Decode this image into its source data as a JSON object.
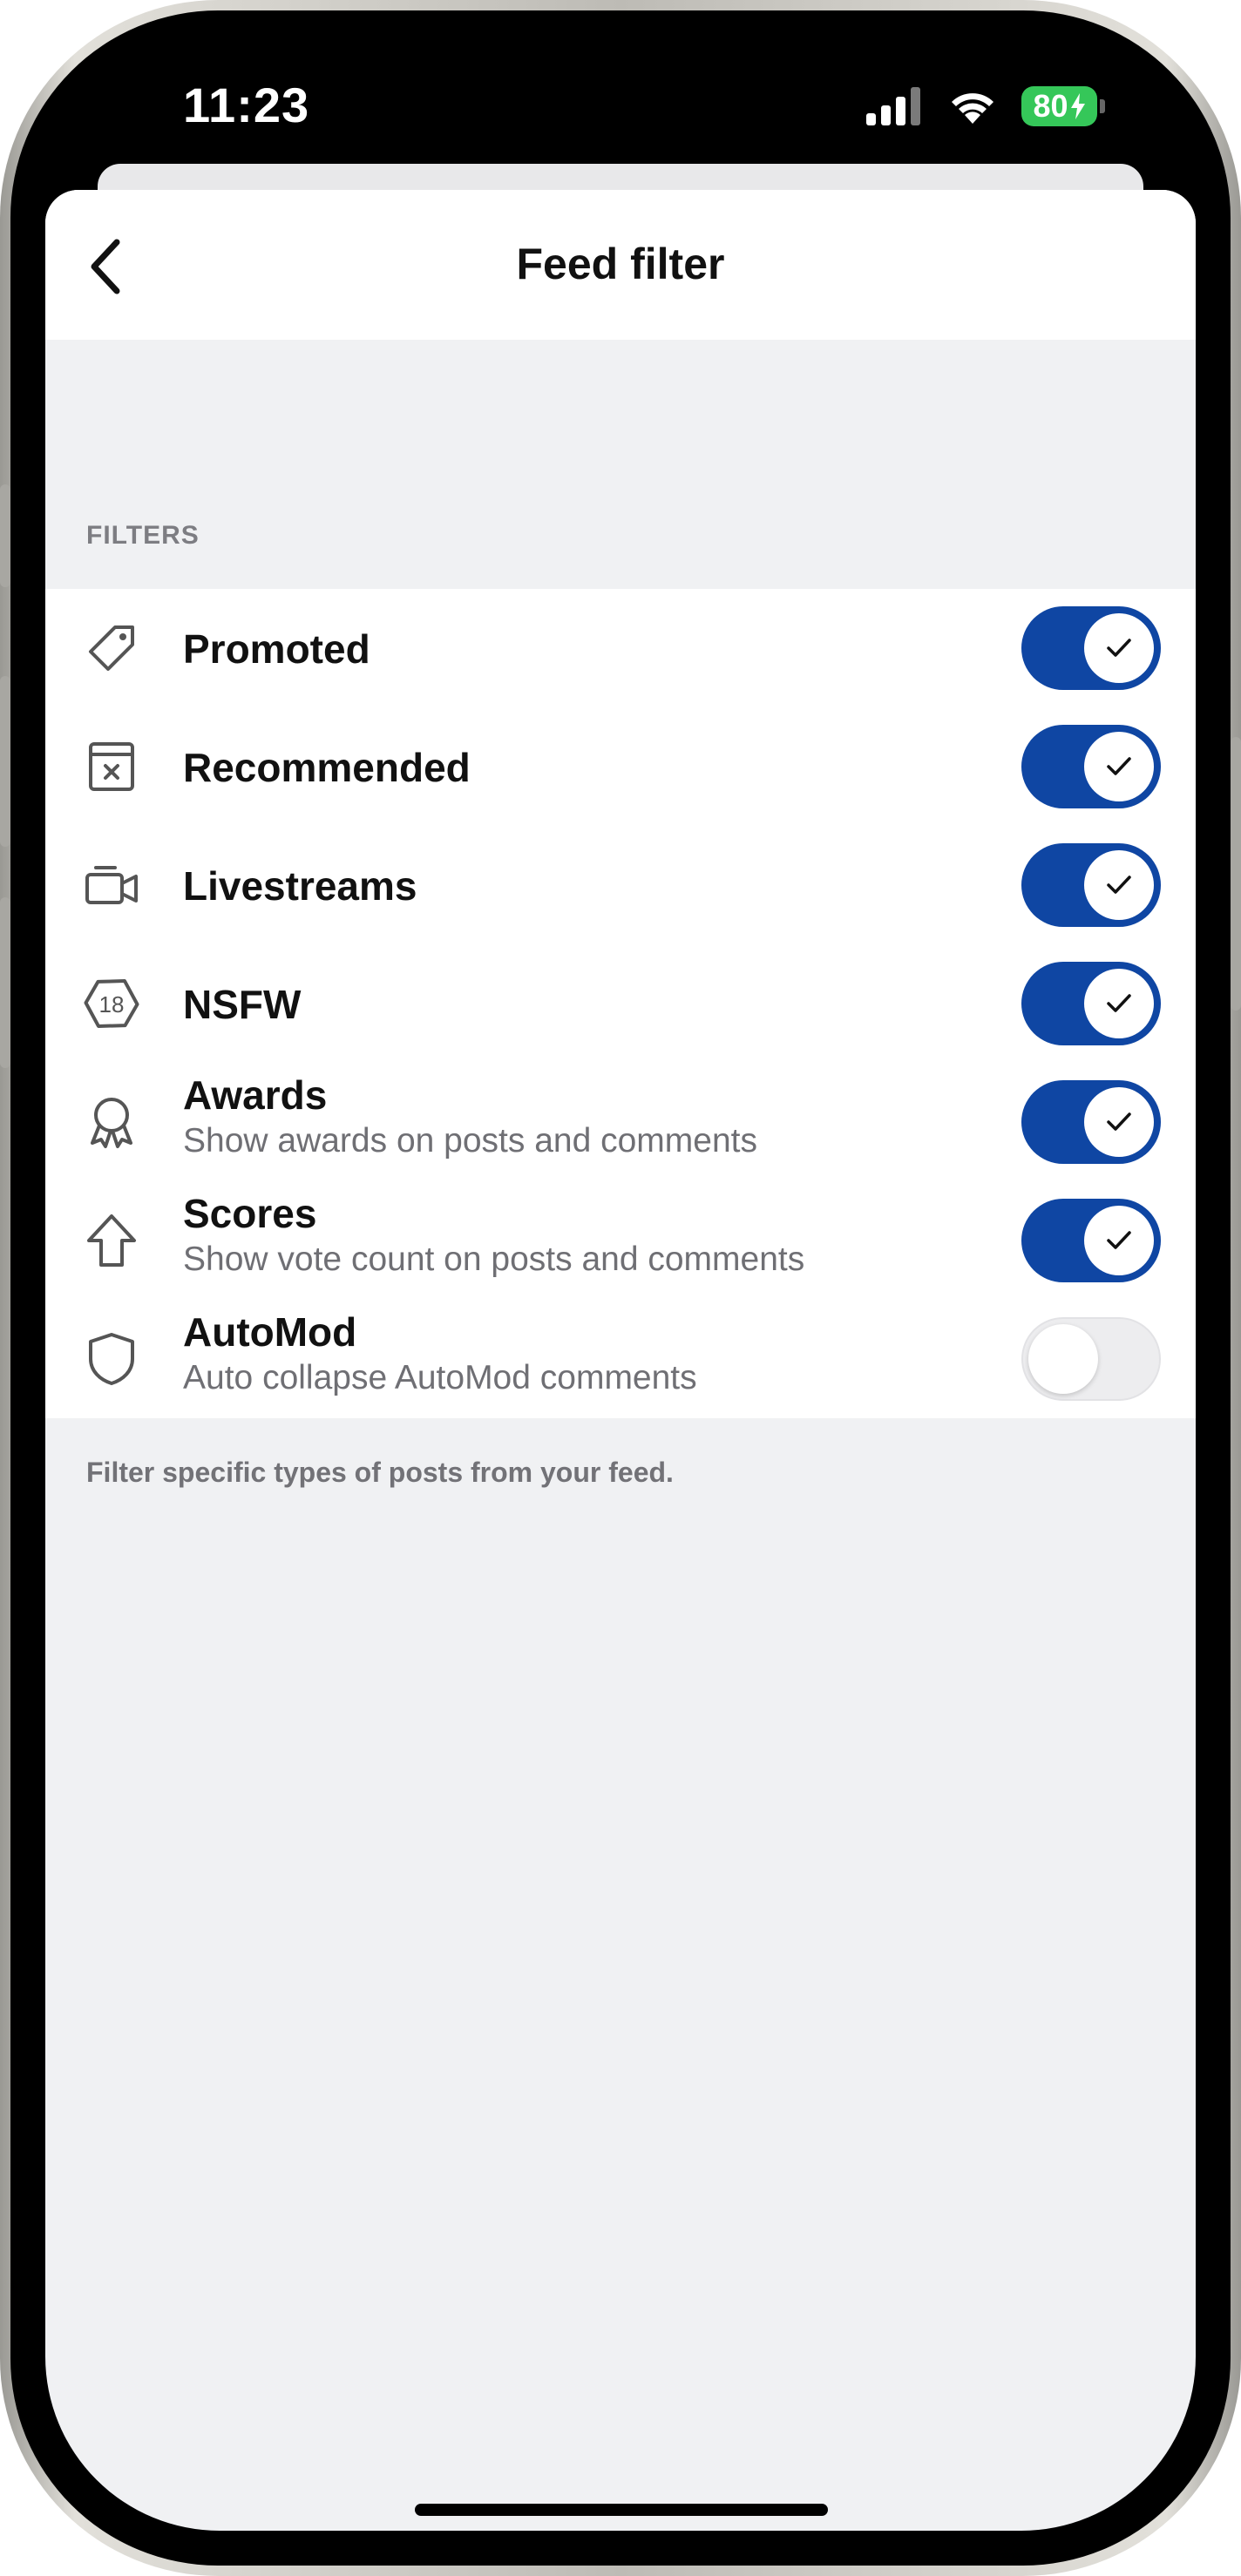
{
  "status_bar": {
    "time": "11:23",
    "battery_percent": "80",
    "battery_charging": true,
    "icons": [
      "cellular-signal-icon",
      "wifi-icon",
      "battery-icon"
    ]
  },
  "nav": {
    "back_icon": "chevron-left-icon",
    "title": "Feed filter"
  },
  "section": {
    "header": "FILTERS",
    "footer": "Filter specific types of posts from your feed."
  },
  "filters": [
    {
      "label": "Promoted",
      "sublabel": "",
      "icon": "tag-icon",
      "enabled": true
    },
    {
      "label": "Recommended",
      "sublabel": "",
      "icon": "recommended-x-icon",
      "enabled": true
    },
    {
      "label": "Livestreams",
      "sublabel": "",
      "icon": "video-camera-icon",
      "enabled": true
    },
    {
      "label": "NSFW",
      "sublabel": "",
      "icon": "nsfw-18-icon",
      "enabled": true
    },
    {
      "label": "Awards",
      "sublabel": "Show awards on posts and comments",
      "icon": "award-icon",
      "enabled": true
    },
    {
      "label": "Scores",
      "sublabel": "Show vote count on posts and comments",
      "icon": "upvote-arrow-icon",
      "enabled": true
    },
    {
      "label": "AutoMod",
      "sublabel": "Auto collapse AutoMod comments",
      "icon": "shield-icon",
      "enabled": false
    }
  ],
  "colors": {
    "toggle_on": "#0f46a3",
    "toggle_off": "#ededef",
    "battery": "#35c759",
    "sheet_background": "#f0f1f3"
  }
}
